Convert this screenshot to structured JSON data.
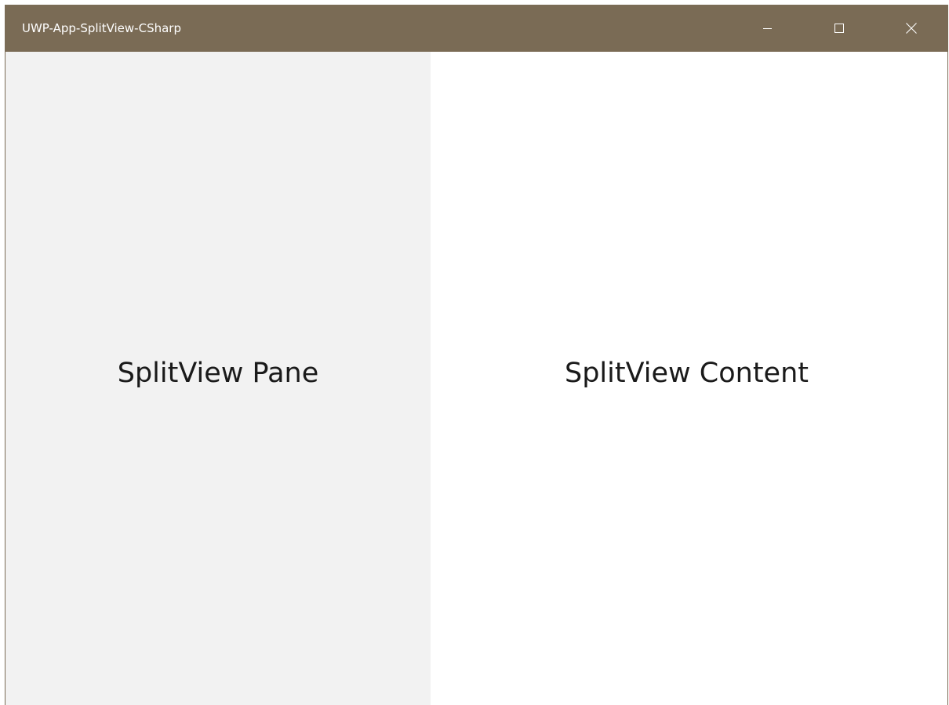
{
  "window": {
    "title": "UWP-App-SplitView-CSharp",
    "accent_color": "#7a6b55",
    "controls": [
      {
        "name": "minimize",
        "icon": "minimize-icon"
      },
      {
        "name": "maximize",
        "icon": "maximize-icon"
      },
      {
        "name": "close",
        "icon": "close-icon"
      }
    ]
  },
  "splitview": {
    "pane": {
      "label": "SplitView Pane",
      "background": "#f2f2f2"
    },
    "content": {
      "label": "SplitView Content",
      "background": "#ffffff"
    }
  }
}
